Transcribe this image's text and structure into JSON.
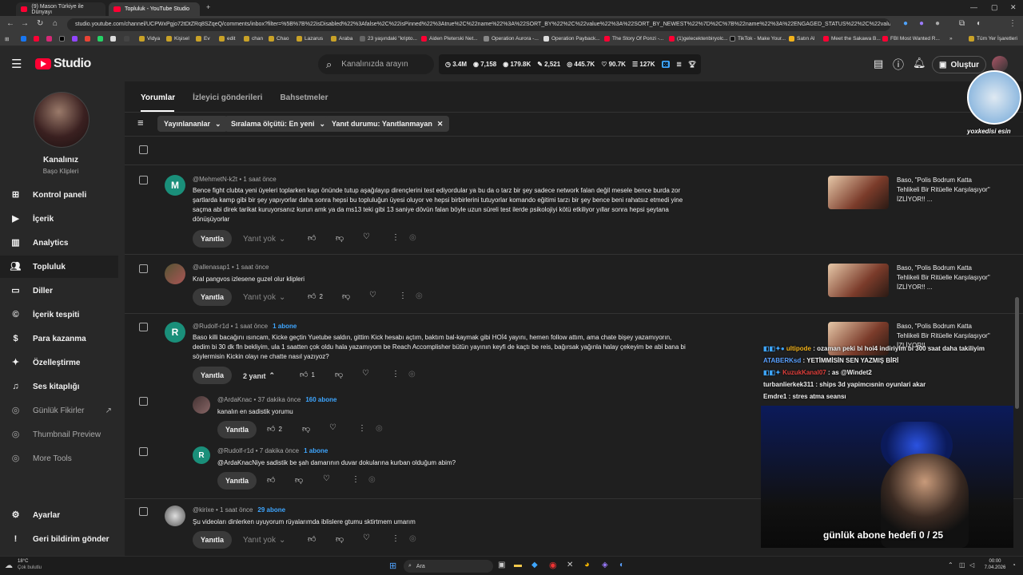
{
  "browser": {
    "tabs": [
      {
        "label": "(9) Mason Türkiye ile Dünyayı",
        "active": false
      },
      {
        "label": "Topluluk - YouTube Studio",
        "active": true
      }
    ],
    "url": "studio.youtube.com/channel/UCPWxPgjo72tDtZRq8SZqeQ/comments/inbox?filter=%5B%7B%22isDisabled%22%3Afalse%2C%22isPinned%22%3Atrue%2C%22name%22%3A%22SORT_BY%22%2C%22value%22%3A%22SORT_BY_NEWEST%22%7D%2C%7B%22name%22%3A%22ENGAGED_STATUS%22%2C%22value%22%3A%5B%22COMMENT_CATEGORY_NOT_ENGAGED%22%5D%7D...",
    "bookmarks": [
      "Vidya",
      "Kişisel",
      "Ev",
      "edit",
      "chan",
      "Chao",
      "Lazarus",
      "Araba",
      "23 yaşındaki \"kripto...",
      "Aiden Pleterski Net...",
      "Operation Aurora -...",
      "Operation Payback...",
      "The Story Of Ponzi -...",
      "(1)gelecektenbiryolc...",
      "TikTok - Make Your...",
      "Satın Al",
      "Meet the Sakawa B...",
      "FBI Most Wanted R...",
      "Tüm Yer İşaretleri"
    ]
  },
  "header": {
    "logo": "Studio",
    "search_placeholder": "Kanalınızda arayın",
    "stats": [
      "3.4M",
      "7,158",
      "179.8K",
      "2,521",
      "445.7K",
      "90.7K",
      "127K"
    ],
    "create_label": "Oluştur"
  },
  "sidebar": {
    "channel_title": "Kanalınız",
    "channel_sub": "Başo Klipleri",
    "items": [
      {
        "label": "Kontrol paneli",
        "icon": "dashboard-icon"
      },
      {
        "label": "İçerik",
        "icon": "content-icon"
      },
      {
        "label": "Analytics",
        "icon": "analytics-icon"
      },
      {
        "label": "Topluluk",
        "icon": "community-icon"
      },
      {
        "label": "Diller",
        "icon": "subtitles-icon"
      },
      {
        "label": "İçerik tespiti",
        "icon": "copyright-icon"
      },
      {
        "label": "Para kazanma",
        "icon": "monetization-icon"
      },
      {
        "label": "Özelleştirme",
        "icon": "customization-icon"
      },
      {
        "label": "Ses kitaplığı",
        "icon": "audio-library-icon"
      },
      {
        "label": "Günlük Fikirler",
        "icon": "extension-icon"
      },
      {
        "label": "Thumbnail Preview",
        "icon": "extension-icon"
      },
      {
        "label": "More Tools",
        "icon": "extension-icon"
      }
    ],
    "settings": "Ayarlar",
    "feedback": "Geri bildirim gönder"
  },
  "main": {
    "tabs": [
      "Yorumlar",
      "İzleyici gönderileri",
      "Bahsetmeler"
    ],
    "filters": [
      "Yayınlananlar",
      "Sıralama ölçütü: En yeni",
      "Yanıt durumu: Yanıtlanmayan"
    ],
    "reply_label": "Yanıtla",
    "not_replied_label": "Yanıt yok",
    "video_title": "Baso, \"Polis Bodrum Katta Tehlikeli Bir Ritüelle Karşılaşıyor\" İZLİYOR!! ..."
  },
  "comments": [
    {
      "author": "@MehmetN-k2t",
      "time": "1 saat önce",
      "subs": "",
      "text": "Bence fight clubta yeni üyeleri toplarken kapı önünde tutup aşağılayıp dirençlerini test ediyordular ya bu da o tarz bir şey sadece network falan değil mesele bence burda zor şartlarda kamp gibi bir şey yapıyorlar daha sonra hepsi bu topluluğun üyesi oluyor ve hepsi birbirlerini tutuyorlar komando eğitimi tarzı bir şey bence beni rahatsız etmedi yine saçma abi direk tarikat kuruyorsanız kurun amk ya da ms13 teki gibi 13 saniye dövün falan böyle uzun süreli test ilerde psikolojiyi kötü etkiliyor yıllar sonra hepsi şeytana dönüşüyorlar",
      "likes": "",
      "replies": ""
    },
    {
      "author": "@allenasap1",
      "time": "1 saat önce",
      "subs": "",
      "text": "Kral pangvos izlesene guzel olur klipleri",
      "likes": "2",
      "replies": ""
    },
    {
      "author": "@Rudolf-r1d",
      "time": "1 saat önce",
      "subs": "1 abone",
      "text": "Baso killi bacağını ısıncam, Kicke geçtin Yuetube saldın, gittim Kick hesabı açtım, baktım bal-kaymak gibi HOİ4 yayını, hemen follow attım, ama chate bişey yazamıyorın, dedim bi 30 dk fln bekliyim, ula 1 saatten çok oldu hala yazamıyom be Reach Accomplisher bütün yayının keyfi de kaçtı be reis, bağırsak yağınla halay çekeyim be abi bana bi söylermisin Kickin olayı ne chatte nasıl yazıyoz?",
      "likes": "1",
      "replies": "2 yanıt"
    },
    {
      "author": "@ArdaKnac",
      "time": "37 dakika önce",
      "subs": "160 abone",
      "text": "kanalın en sadistik yorumu",
      "likes": "2",
      "replies": ""
    },
    {
      "author": "@Rudolf-r1d",
      "time": "7 dakika önce",
      "subs": "1 abone",
      "text": "@ArdaKnacNiye sadistik be şah damarının duvar dokularına kurban olduğum abim?",
      "likes": "",
      "replies": ""
    },
    {
      "author": "@kirixe",
      "time": "1 saat önce",
      "subs": "29 abone",
      "text": "Şu videoları dinlerken uyuyorum rüyalarımda iblislere gtumu sktirtmem umarım",
      "likes": "",
      "replies": ""
    }
  ],
  "stream": {
    "chat": [
      {
        "user": "ultipode",
        "msg": "ozaman peki bi hoi4 indiriyim bi 300 saat daha takiliyim",
        "color": "#f2b21b"
      },
      {
        "user": "ATABERKsd",
        "msg": "YETİMMİSİN SEN YAZMIŞ BİRİ",
        "color": "#5aa0ff"
      },
      {
        "user": "KuzukKanal07",
        "msg": "as @Windet2",
        "color": "#e0403c"
      },
      {
        "user": "turbanlierkek311",
        "msg": "ships 3d yapimcısnin oyunlari akar",
        "color": "#ffffff"
      },
      {
        "user": "Emdre1",
        "msg": "stres atma seansı",
        "color": "#ffffff"
      }
    ],
    "caption": "günlük abone hedefi 0 / 25",
    "cat_label": "yoxkedisi esin"
  },
  "taskbar": {
    "weather_temp": "18°C",
    "weather_text": "Çok bulutlu",
    "search": "Ara",
    "time": "00:00",
    "date": "7.04.2026"
  }
}
